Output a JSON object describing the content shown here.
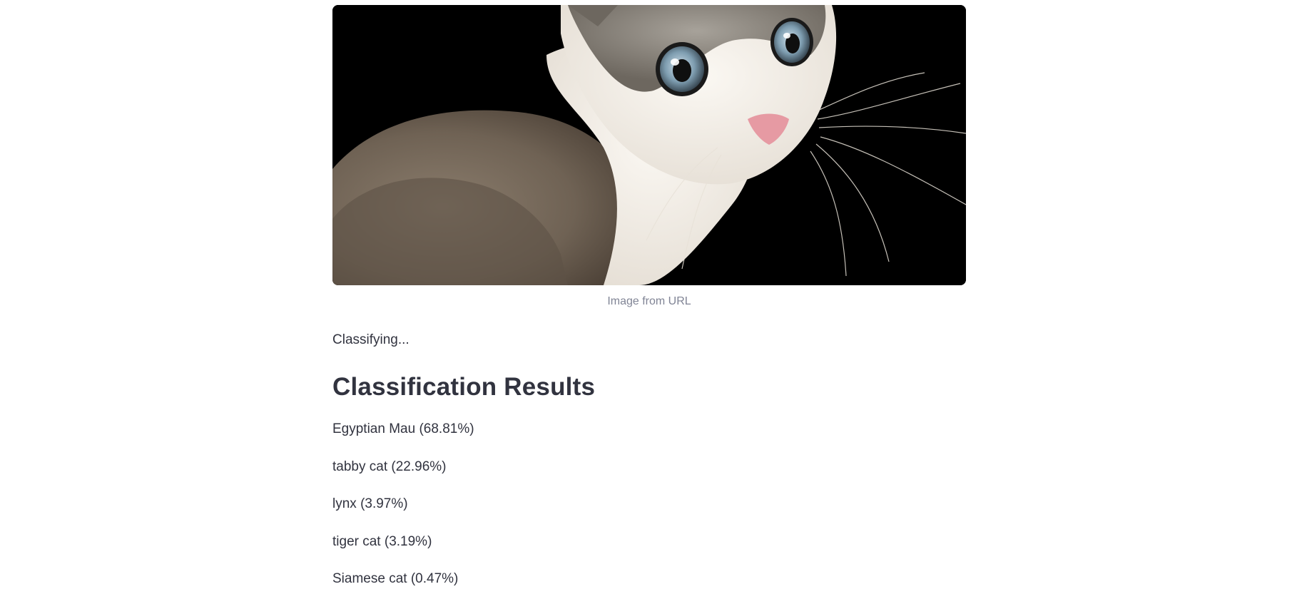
{
  "image": {
    "alt": "Photo of a grey tabby and white cat looking over its shoulder on a black background",
    "caption": "Image from URL"
  },
  "status_text": "Classifying...",
  "results": {
    "heading": "Classification Results",
    "items": [
      {
        "label": "Egyptian Mau (68.81%)"
      },
      {
        "label": "tabby cat (22.96%)"
      },
      {
        "label": "lynx (3.97%)"
      },
      {
        "label": "tiger cat (3.19%)"
      },
      {
        "label": "Siamese cat (0.47%)"
      }
    ]
  },
  "colors": {
    "text": "#31333f",
    "caption": "#808495",
    "background": "#ffffff"
  }
}
